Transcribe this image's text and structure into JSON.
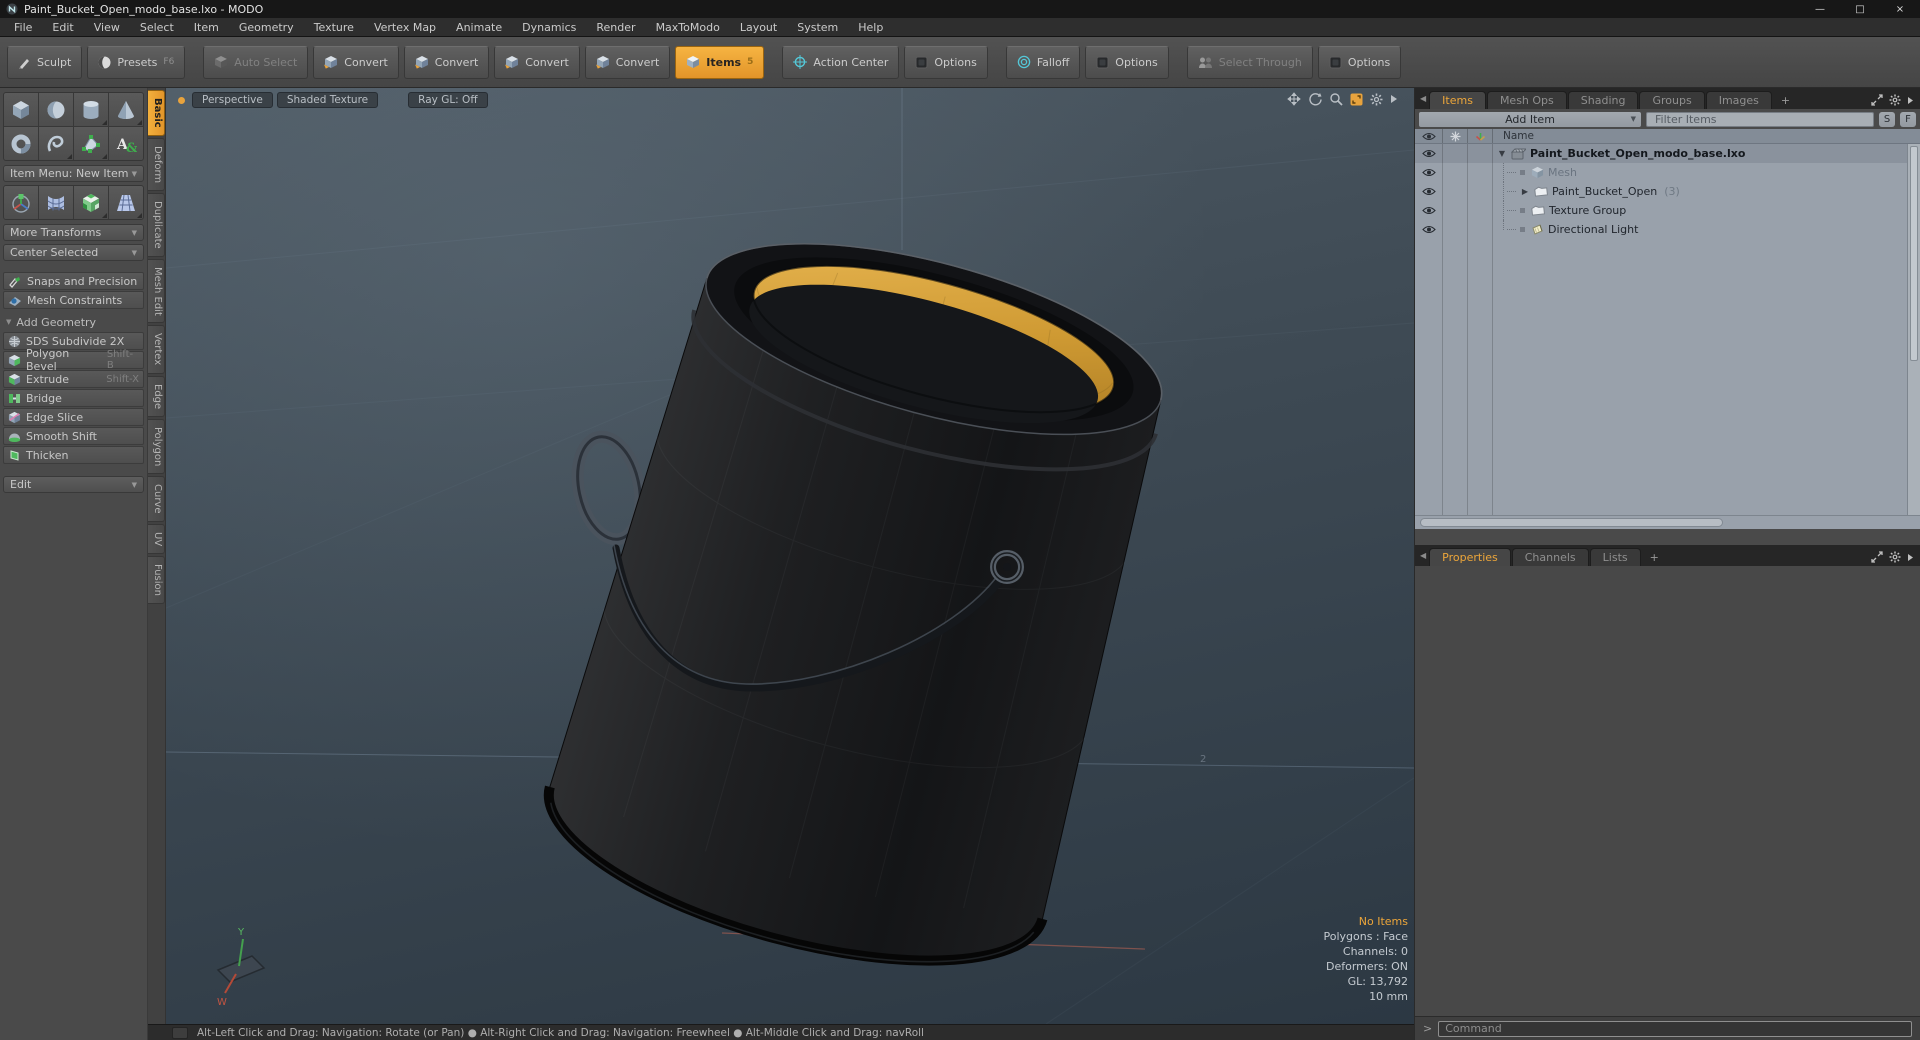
{
  "window": {
    "title": "Paint_Bucket_Open_modo_base.lxo - MODO",
    "controls": {
      "min": "—",
      "max": "□",
      "close": "×"
    }
  },
  "menu": {
    "items": [
      "File",
      "Edit",
      "View",
      "Select",
      "Item",
      "Geometry",
      "Texture",
      "Vertex Map",
      "Animate",
      "Dynamics",
      "Render",
      "MaxToModo",
      "Layout",
      "System",
      "Help"
    ]
  },
  "toolbar": {
    "sculpt": "Sculpt",
    "presets": "Presets",
    "presets_shortcut": "F6",
    "auto_select": "Auto Select",
    "convert1": "Convert",
    "convert2": "Convert",
    "convert3": "Convert",
    "convert4": "Convert",
    "items": "Items",
    "items_shortcut": "5",
    "action_center": "Action Center",
    "options1": "Options",
    "falloff": "Falloff",
    "options2": "Options",
    "select_through": "Select Through",
    "options3": "Options"
  },
  "toolbox": {
    "item_menu": "Item Menu: New Item",
    "more_transforms": "More Transforms",
    "center_selected": "Center Selected",
    "snaps": "Snaps and Precision",
    "mesh_constraints": "Mesh Constraints",
    "add_geometry": "Add Geometry",
    "tools": [
      {
        "label": "SDS Subdivide 2X",
        "shortcut": ""
      },
      {
        "label": "Polygon Bevel",
        "shortcut": "Shift-B"
      },
      {
        "label": "Extrude",
        "shortcut": "Shift-X"
      },
      {
        "label": "Bridge",
        "shortcut": ""
      },
      {
        "label": "Edge Slice",
        "shortcut": ""
      },
      {
        "label": "Smooth Shift",
        "shortcut": ""
      },
      {
        "label": "Thicken",
        "shortcut": ""
      }
    ],
    "edit": "Edit"
  },
  "side_tabs": [
    "Basic",
    "Deform",
    "Duplicate",
    "Mesh Edit",
    "Vertex",
    "Edge",
    "Polygon",
    "Curve",
    "UV",
    "Fusion"
  ],
  "viewport": {
    "tabs": [
      "Perspective",
      "Shaded Texture",
      "Ray GL: Off"
    ],
    "stats": [
      "No Items",
      "Polygons : Face",
      "Channels: 0",
      "Deformers: ON",
      "GL: 13,792",
      "10 mm"
    ],
    "axis_y": "Y",
    "axis_w": "W",
    "grid_label": "2"
  },
  "items_panel": {
    "tabs": [
      "Items",
      "Mesh Ops",
      "Shading",
      "Groups",
      "Images"
    ],
    "plus": "+",
    "add_item": "Add Item",
    "filter_placeholder": "Filter Items",
    "btn_s": "S",
    "btn_f": "F",
    "name_header": "Name",
    "rows": [
      {
        "label": "Paint_Bucket_Open_modo_base.lxo",
        "suffix": ""
      },
      {
        "label": "Mesh",
        "suffix": ""
      },
      {
        "label": "Paint_Bucket_Open",
        "suffix": "(3)"
      },
      {
        "label": "Texture Group",
        "suffix": ""
      },
      {
        "label": "Directional Light",
        "suffix": ""
      }
    ]
  },
  "props_panel": {
    "tabs": [
      "Properties",
      "Channels",
      "Lists"
    ],
    "plus": "+"
  },
  "command": {
    "prompt": ">",
    "placeholder": "Command"
  },
  "status": {
    "text": "Alt-Left Click and Drag: Navigation: Rotate (or Pan)   ●   Alt-Right Click and Drag: Navigation: Freewheel   ●   Alt-Middle Click and Drag: navRoll"
  },
  "colors": {
    "accent": "#eda63a",
    "paint": "#d09a33",
    "viewport_top": "#4d5862",
    "viewport_bottom": "#2d3944"
  }
}
